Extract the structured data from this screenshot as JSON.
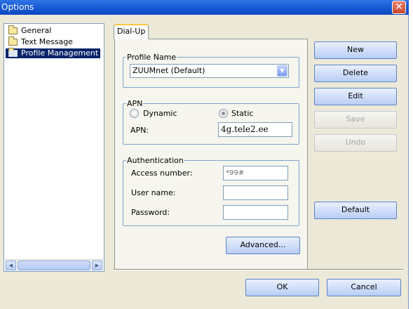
{
  "window": {
    "title": "Options",
    "close_glyph": "✕"
  },
  "tree": {
    "items": [
      {
        "label": "General",
        "icon": "folder-icon"
      },
      {
        "label": "Text Message",
        "icon": "folder-icon"
      },
      {
        "label": "Profile Management",
        "icon": "folder-open-icon",
        "selected": true
      }
    ]
  },
  "tab": {
    "label": "Dial-Up"
  },
  "profile": {
    "group_label": "Profile Name",
    "selected": "ZUUMnet (Default)"
  },
  "apn": {
    "group_label": "APN",
    "dynamic_label": "Dynamic",
    "static_label": "Static",
    "selected": "Static",
    "field_label": "APN:",
    "value": "4g.tele2.ee"
  },
  "auth": {
    "group_label": "Authentication",
    "access_label": "Access number:",
    "access_value": "*99#",
    "user_label": "User name:",
    "user_value": "",
    "password_label": "Password:",
    "password_value": ""
  },
  "buttons": {
    "new": "New",
    "delete": "Delete",
    "edit": "Edit",
    "save": "Save",
    "undo": "Undo",
    "default": "Default",
    "advanced": "Advanced...",
    "ok": "OK",
    "cancel": "Cancel"
  },
  "colors": {
    "titlebar": "#1c5fd8",
    "selection": "#0a246a",
    "dialog_bg": "#ece9d8"
  }
}
